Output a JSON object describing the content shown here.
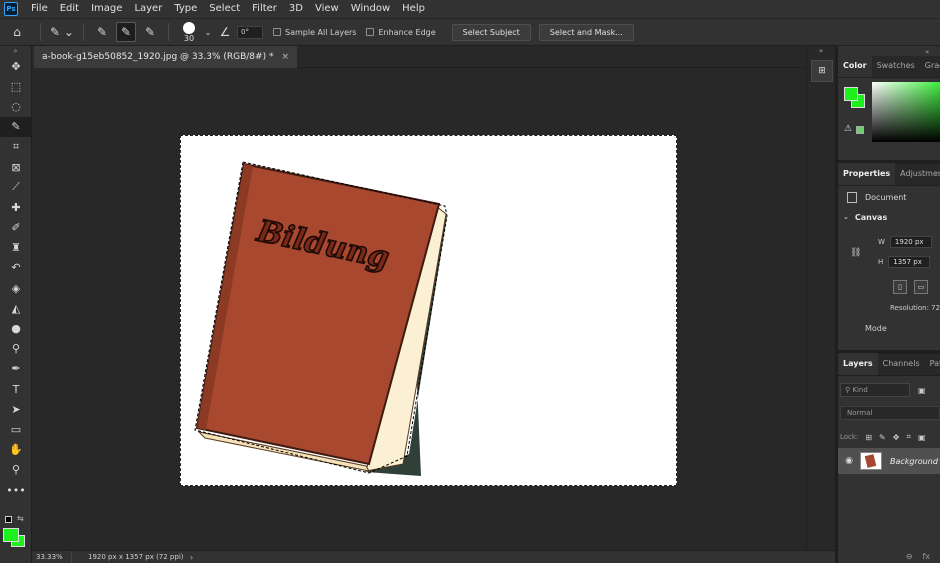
{
  "app": {
    "logo": "Ps",
    "menu": [
      "File",
      "Edit",
      "Image",
      "Layer",
      "Type",
      "Select",
      "Filter",
      "3D",
      "View",
      "Window",
      "Help"
    ]
  },
  "options": {
    "brush_size": "30",
    "angle": "0°",
    "sample_all_layers": "Sample All Layers",
    "enhance_edge": "Enhance Edge",
    "select_subject": "Select Subject",
    "select_and_mask": "Select and Mask..."
  },
  "document": {
    "tab_title": "a-book-g15eb50852_1920.jpg @ 33.3% (RGB/8#) *",
    "close": "×",
    "book_title": "Bildung",
    "book_color": "#a8482e"
  },
  "status": {
    "zoom": "33.33%",
    "doc_info": "1920 px x 1357 px (72 ppi)",
    "arrow": "›"
  },
  "colors": {
    "foreground": "#1ef01e",
    "background": "#1ef01e"
  },
  "color_panel": {
    "tabs": [
      "Color",
      "Swatches",
      "Grad"
    ]
  },
  "properties": {
    "tabs": [
      "Properties",
      "Adjustments"
    ],
    "document_label": "Document",
    "canvas_label": "Canvas",
    "w_label": "W",
    "w_value": "1920 px",
    "h_label": "H",
    "h_value": "1357 px",
    "resolution": "Resolution: 72",
    "mode": "Mode"
  },
  "layers": {
    "tabs": [
      "Layers",
      "Channels",
      "Path"
    ],
    "kind_placeholder": "Kind",
    "blend_mode": "Normal",
    "lock_label": "Lock:",
    "layer_name": "Background",
    "footer_link": "⊖",
    "footer_fx": "fx"
  }
}
